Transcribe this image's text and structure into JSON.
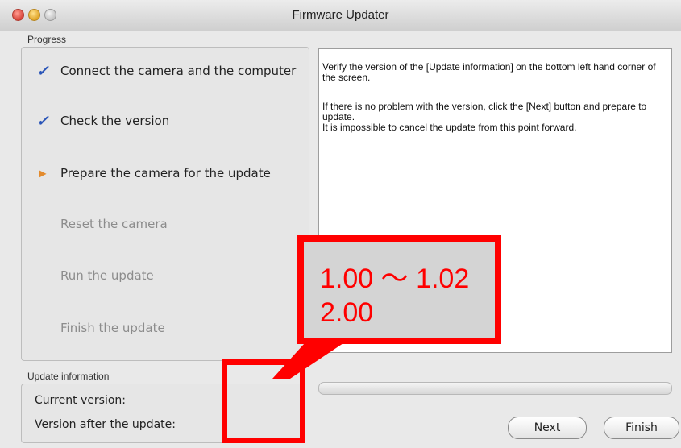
{
  "window": {
    "title": "Firmware Updater"
  },
  "progress": {
    "label": "Progress",
    "steps": [
      {
        "label": "Connect the camera and the computer",
        "status": "done",
        "icon": "checkmark-icon"
      },
      {
        "label": "Check the version",
        "status": "done",
        "icon": "checkmark-icon"
      },
      {
        "label": "Prepare the camera for the update",
        "status": "current",
        "icon": "arrow-right-icon"
      },
      {
        "label": "Reset the camera",
        "status": "pending",
        "icon": ""
      },
      {
        "label": "Run the update",
        "status": "pending",
        "icon": ""
      },
      {
        "label": "Finish the update",
        "status": "pending",
        "icon": ""
      }
    ]
  },
  "info": {
    "para1": "Verify the version of the [Update information] on the bottom left hand corner of the screen.",
    "para2_line1": "If there is no problem with the version, click the [Next] button and prepare to update.",
    "para2_line2": "It is impossible to cancel the update from this point forward."
  },
  "update_info": {
    "label": "Update information",
    "current_version_label": "Current version:",
    "after_version_label": "Version after the update:"
  },
  "buttons": {
    "next": "Next",
    "finish": "Finish"
  },
  "annotation": {
    "line1": "1.00 〜 1.02",
    "line2": "2.00",
    "color": "#ff0000"
  },
  "colors": {
    "check": "#2a55b8",
    "arrow": "#e38b2e"
  }
}
